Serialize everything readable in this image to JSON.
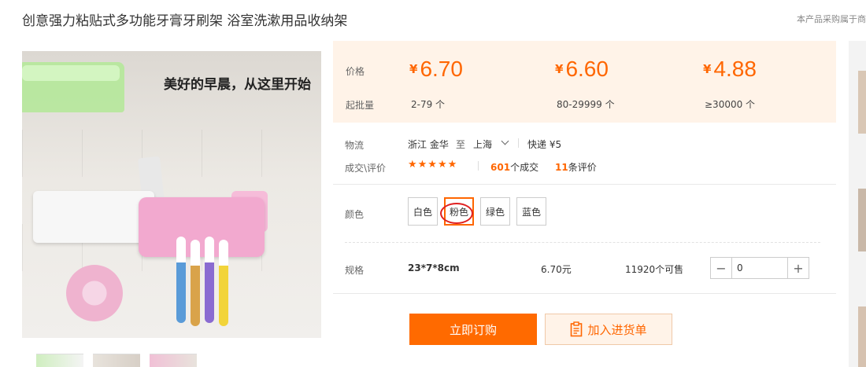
{
  "product": {
    "title": "创意强力粘贴式多功能牙膏牙刷架 浴室洗漱用品收纳架",
    "top_note": "本产品采购属于商",
    "image_promo": "美好的早晨，从这里开始"
  },
  "pricing": {
    "price_label": "价格",
    "moq_label": "起批量",
    "currency": "¥",
    "tiers": [
      {
        "price": "6.70",
        "qty": "2-79 个"
      },
      {
        "price": "6.60",
        "qty": "80-29999 个"
      },
      {
        "price": "4.88",
        "qty": "≥30000 个"
      }
    ]
  },
  "logistics": {
    "label": "物流",
    "from": "浙江 金华",
    "to_word": "至",
    "to": "上海",
    "method": "快递 ¥5"
  },
  "deals": {
    "label": "成交\\评价",
    "stars": "★★★★★",
    "deal_count": "601",
    "deal_suffix": "个成交",
    "review_count": "11",
    "review_suffix": "条评价"
  },
  "color": {
    "label": "颜色",
    "options": [
      "白色",
      "粉色",
      "绿色",
      "蓝色"
    ],
    "selected": "粉色"
  },
  "spec": {
    "label": "规格",
    "size": "23*7*8cm",
    "price": "6.70元",
    "stock": "11920个可售",
    "quantity": "0",
    "minus": "−",
    "plus": "+"
  },
  "actions": {
    "order_label": "立即订购",
    "cart_label": "加入进货单"
  },
  "colors": {
    "accent": "#ff6600",
    "price_bg": "#fff3e8",
    "highlight_circle": "#e02020"
  }
}
